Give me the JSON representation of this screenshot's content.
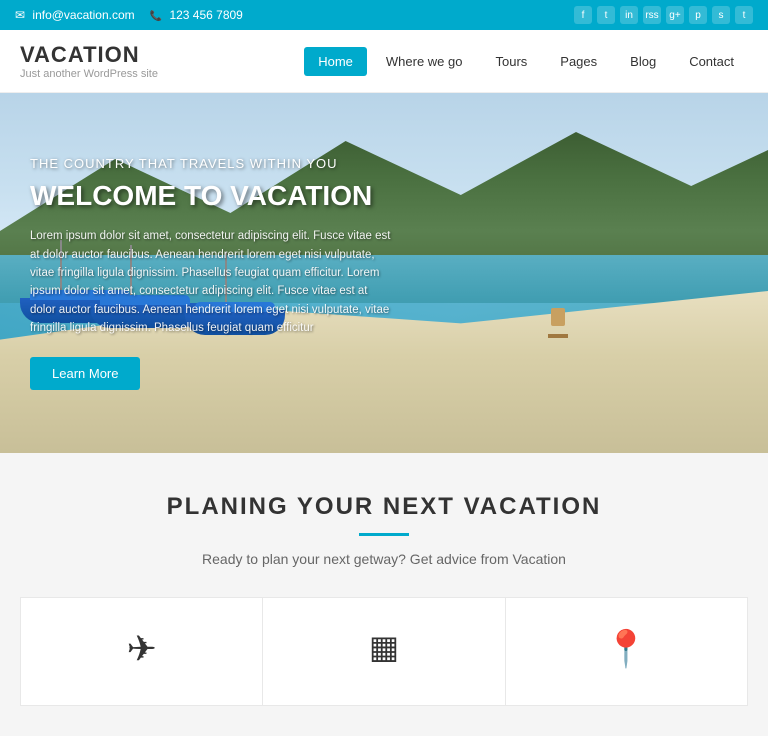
{
  "topbar": {
    "email": "info@vacation.com",
    "phone": "123 456 7809",
    "email_icon": "✉",
    "phone_icon": "📞",
    "social": [
      "f",
      "t",
      "in",
      "rss",
      "g+",
      "p",
      "s",
      "t2"
    ]
  },
  "header": {
    "logo_title": "VACATION",
    "logo_subtitle": "Just another WordPress site",
    "nav_items": [
      {
        "label": "Home",
        "active": true
      },
      {
        "label": "Where we go",
        "active": false
      },
      {
        "label": "Tours",
        "active": false
      },
      {
        "label": "Pages",
        "active": false
      },
      {
        "label": "Blog",
        "active": false
      },
      {
        "label": "Contact",
        "active": false
      }
    ]
  },
  "hero": {
    "subtitle": "THE COUNTRY THAT TRAVELS WITHIN YOU",
    "title": "WELCOME TO VACATION",
    "body_text": "Lorem ipsum dolor sit amet, consectetur adipiscing elit. Fusce vitae est at dolor auctor faucibus. Aenean hendrerit lorem eget nisi vulputate, vitae fringilla ligula dignissim. Phasellus feugiat quam efficitur. Lorem ipsum dolor sit amet, consectetur adipiscing elit. Fusce vitae est at dolor auctor faucibus. Aenean hendrerit lorem eget nisi vulputate, vitae fringilla ligula dignissim. Phasellus feugiat quam efficitur",
    "cta_button": "Learn More"
  },
  "planning": {
    "title": "PLANING YOUR NEXT VACATION",
    "subtitle": "Ready to plan your next getway? Get advice from Vacation",
    "divider_color": "#00aacc"
  },
  "cards": [
    {
      "icon": "✈",
      "name": "flights"
    },
    {
      "icon": "▦",
      "name": "hotels"
    },
    {
      "icon": "📍",
      "name": "destinations"
    }
  ],
  "colors": {
    "primary": "#00aacc",
    "dark": "#333333",
    "light_bg": "#f5f5f5"
  }
}
